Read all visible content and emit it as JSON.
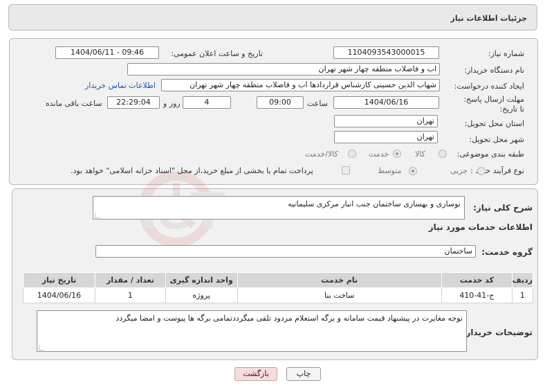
{
  "header": {
    "title": "جزئیات اطلاعات نیاز"
  },
  "form": {
    "need_number_label": "شماره نیاز:",
    "need_number": "1104093543000015",
    "announce_label": "تاریخ و ساعت اعلان عمومی:",
    "announce_value": "1404/06/11 - 09:46",
    "buyer_org_label": "نام دستگاه خریدار:",
    "buyer_org": "اب و فاضلاب منطقه چهار شهر تهران",
    "creator_label": "ایجاد کننده درخواست:",
    "creator": "شهاب الدین حسینی کارشناس قراردادها  اب و فاضلاب منطقه چهار شهر تهران",
    "contact_link": "اطلاعات تماس خریدار",
    "deadline_label": "مهلت ارسال پاسخ: تا تاریخ:",
    "deadline_date": "1404/06/16",
    "time_label": "ساعت",
    "deadline_time": "09:00",
    "days_value": "4",
    "days_label": "روز و",
    "remaining_time": "22:29:04",
    "remaining_label": "ساعت باقی مانده",
    "province_label": "استان محل تحویل:",
    "province": "تهران",
    "city_label": "شهر محل تحویل:",
    "city": "تهران",
    "category_label": "طبقه بندی موضوعی:",
    "category_options": [
      "کالا",
      "خدمت",
      "کالا/خدمت"
    ],
    "category_selected": "خدمت",
    "process_label": "نوع فرآیند خرید :",
    "process_options": [
      "جزیی",
      "متوسط"
    ],
    "process_selected": "جزیی",
    "payment_note": "پرداخت تمام یا بخشی از مبلغ خرید،از محل \"اسناد خزانه اسلامی\" خواهد بود."
  },
  "services": {
    "summary_label": "شرح کلی نیاز:",
    "summary": "نوسازی و بهسازی ساختمان جنب انبار مرکزی سلیمانیه",
    "section_title": "اطلاعات خدمات مورد نیاز",
    "group_label": "گروه خدمت:",
    "group_value": "ساختمان",
    "table_headers": [
      "ردیف",
      "کد خدمت",
      "نام خدمت",
      "واحد اندازه گیری",
      "تعداد / مقدار",
      "تاریخ نیاز"
    ],
    "rows": [
      [
        "1",
        "ج-41-410",
        "ساخت بنا",
        "پروژه",
        "1",
        "1404/06/16"
      ]
    ],
    "buyer_notes_label": "توضیحات خریدار:",
    "buyer_notes": "توجه مغایرت در پیشنهاد قیمت سامانه و برگه استعلام مردود تلقی میگرددتمامی برگه ها پیوست و امضا میگردد"
  },
  "buttons": {
    "print": "چاپ",
    "back": "بازگشت"
  },
  "watermark": "AriaTender.neT"
}
